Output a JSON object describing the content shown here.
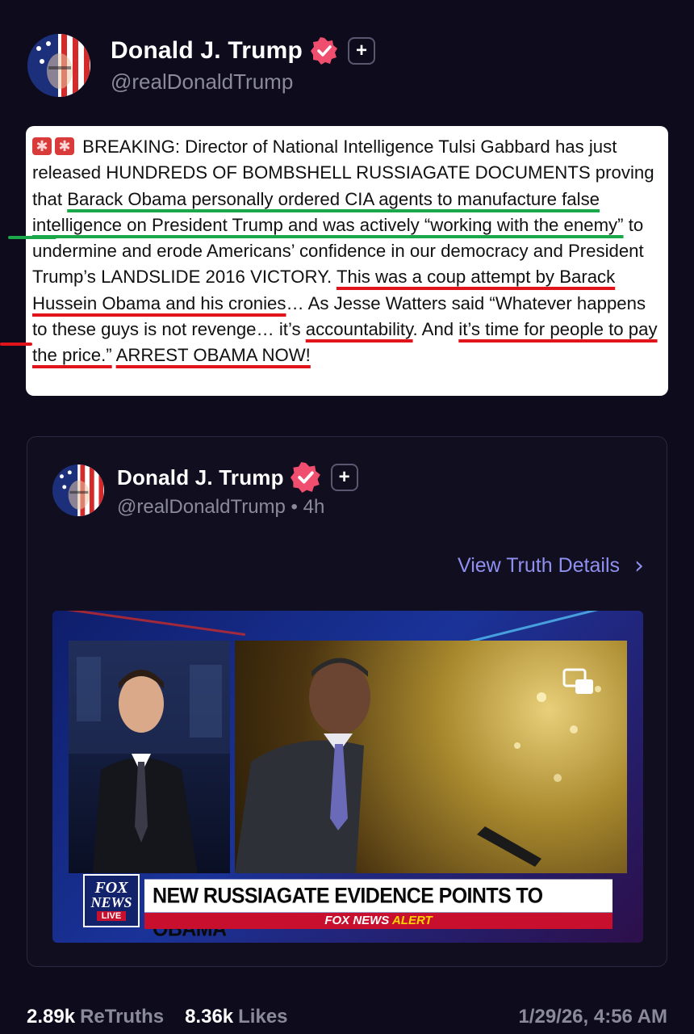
{
  "post": {
    "author_name": "Donald J. Trump",
    "handle": "@realDonaldTrump",
    "text": {
      "p1": "BREAKING: Director of National Intelligence Tulsi Gabbard has just released HUNDREDS OF BOMBSHELL RUSSIAGATE DOCUMENTS proving that ",
      "g1": "Barack Obama personally ordered CIA agents to manufacture false intelligence on President Trump and was actively “working with the enemy”",
      "p2": " to undermine and erode Americans’ confidence in our democracy and President Trump’s LANDSLIDE 2016 VICTORY. ",
      "r1": "This was a coup attempt by Barack Hussein Obama and his cronies",
      "p3": "… As Jesse Watters said “Whatever happens to these guys is not revenge… it’s ",
      "r2": "accountability",
      "p4": ". And ",
      "r3": "it’s time for people to pay the price.”",
      "p5": " ",
      "r4": "ARREST OBAMA NOW!"
    }
  },
  "card": {
    "author_name": "Donald J. Trump",
    "handle_time": "@realDonaldTrump • 4h",
    "view_details": "View Truth Details",
    "video": {
      "logo_line1": "FOX",
      "logo_line2": "NEWS",
      "logo_live": "LIVE",
      "headline": "NEW RUSSIAGATE EVIDENCE POINTS TO OBAMA",
      "alert_prefix": "FOX NEWS",
      "alert_suffix": "ALERT"
    }
  },
  "footer": {
    "retruths_count": "2.89k",
    "retruths_label": "ReTruths",
    "likes_count": "8.36k",
    "likes_label": "Likes",
    "timestamp": "1/29/26, 4:56 AM"
  },
  "colors": {
    "background": "#0e0c1c",
    "verified_badge": "#f04e6e",
    "link": "#8f90f0",
    "underline_green": "#1aa84a",
    "underline_red": "#e0141a"
  }
}
